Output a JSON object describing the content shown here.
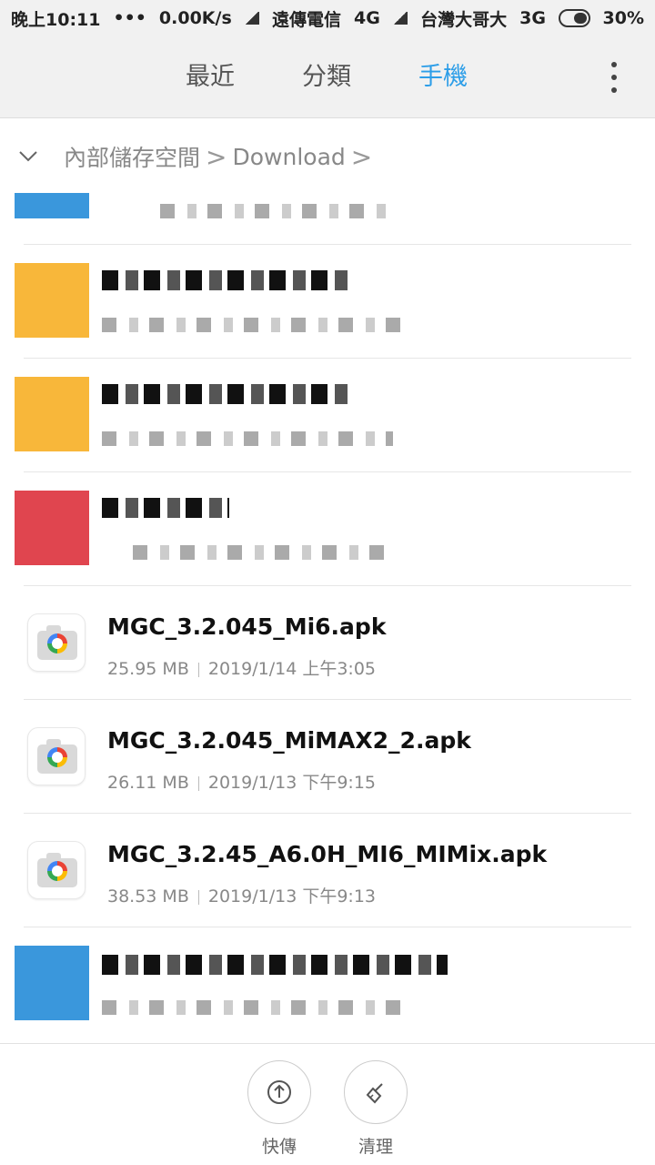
{
  "status_bar": {
    "time": "晚上10:11",
    "dots": "•••",
    "speed": "0.00K/s",
    "carrier1": "遠傳電信",
    "network1": "4G",
    "carrier2": "台灣大哥大",
    "network2": "3G",
    "battery": "30%"
  },
  "tabs": {
    "recent": "最近",
    "category": "分類",
    "phone": "手機",
    "active": "phone",
    "active_color": "#2d9ee8"
  },
  "breadcrumb": {
    "root": "內部儲存空間",
    "folder": "Download",
    "separator": ">"
  },
  "files": [
    {
      "name": "MGC_3.2.045_Mi6.apk",
      "size": "25.95 MB",
      "date": "2019/1/14 上午3:05",
      "icon": "camera-app-icon"
    },
    {
      "name": "MGC_3.2.045_MiMAX2_2.apk",
      "size": "26.11 MB",
      "date": "2019/1/13 下午9:15",
      "icon": "camera-app-icon"
    },
    {
      "name": "MGC_3.2.45_A6.0H_MI6_MIMix.apk",
      "size": "38.53 MB",
      "date": "2019/1/13 下午9:13",
      "icon": "camera-app-icon"
    }
  ],
  "thumb_colors": {
    "blue": "#3a97dc",
    "yellow": "#f8b73a",
    "red": "#e0454f"
  },
  "bottom_actions": {
    "share": "快傳",
    "clean": "清理"
  }
}
